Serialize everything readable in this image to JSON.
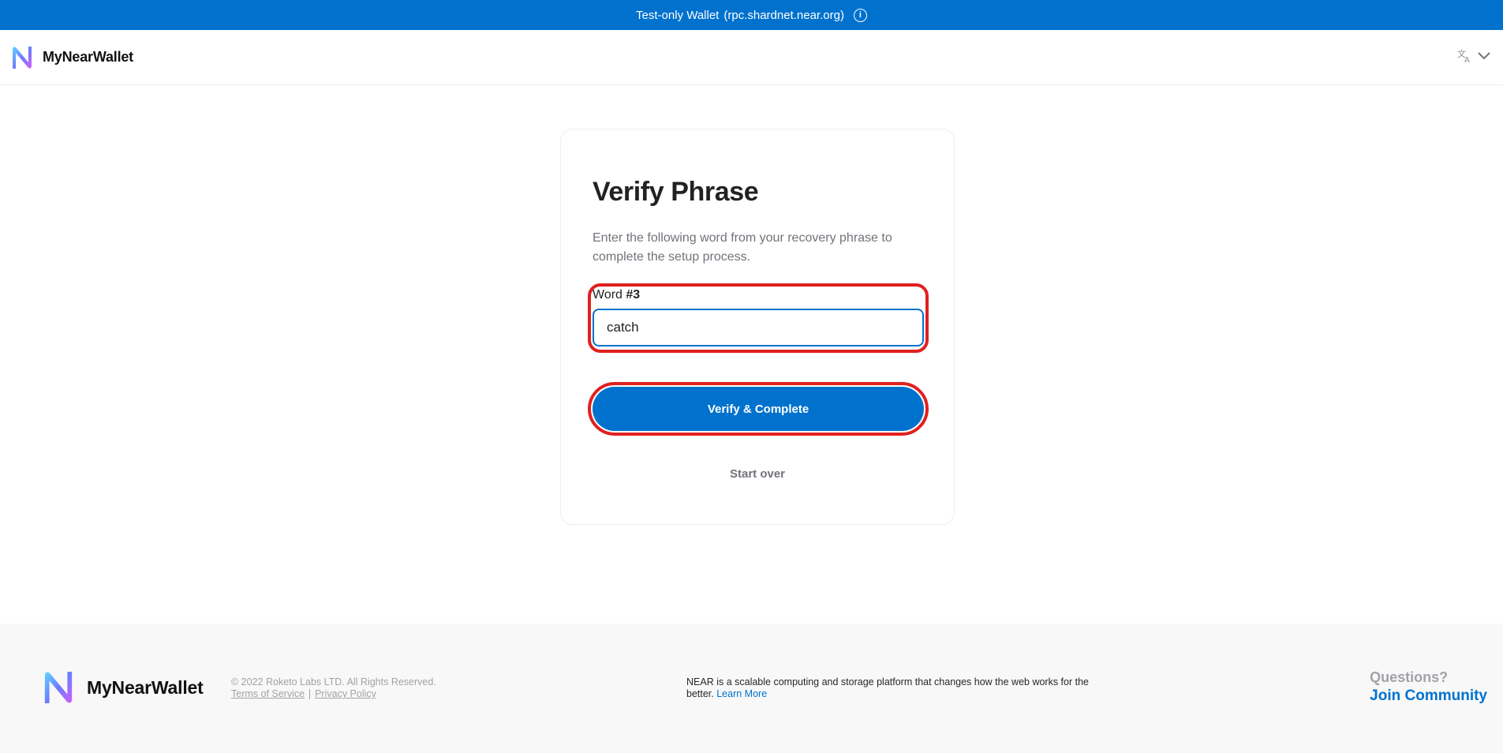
{
  "banner": {
    "label": "Test-only Wallet",
    "rpc": "(rpc.shardnet.near.org)",
    "icon": "info-icon"
  },
  "header": {
    "brand": "MyNearWallet",
    "logo_icon": "mynearwallet-logo-icon",
    "language_icon": "translate-icon",
    "dropdown_icon": "chevron-down-icon"
  },
  "card": {
    "title": "Verify Phrase",
    "description": "Enter the following word from your recovery phrase to complete the setup process.",
    "word_label_prefix": "Word",
    "word_number": "#3",
    "word_value": "catch",
    "primary_button": "Verify & Complete",
    "secondary_link": "Start over"
  },
  "footer": {
    "brand": "MyNearWallet",
    "copyright": "© 2022 Roketo Labs LTD. All Rights Reserved.",
    "terms": "Terms of Service",
    "privacy": "Privacy Policy",
    "about": "NEAR is a scalable computing and storage platform that changes how the web works for the better.",
    "learn_more": "Learn More",
    "questions": "Questions?",
    "join": "Join Community"
  },
  "colors": {
    "accent": "#0072ce",
    "highlight": "#e02020",
    "muted": "#72727a"
  }
}
